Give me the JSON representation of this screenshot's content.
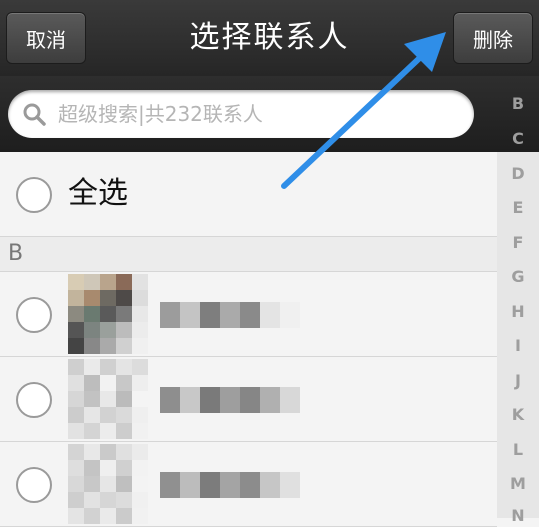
{
  "header": {
    "cancel_label": "取消",
    "title": "选择联系人",
    "delete_label": "删除"
  },
  "search": {
    "placeholder": "超级搜索|共232联系人"
  },
  "list": {
    "select_all_label": "全选",
    "section_header": "B",
    "contacts_visible": 3
  },
  "index_letters": [
    "B",
    "C",
    "D",
    "E",
    "F",
    "G",
    "H",
    "I",
    "J",
    "K",
    "L",
    "M",
    "N"
  ],
  "colors": {
    "header_bg": "#2e2e2e",
    "arrow": "#2f8ee8",
    "list_bg": "#f4f4f4"
  }
}
